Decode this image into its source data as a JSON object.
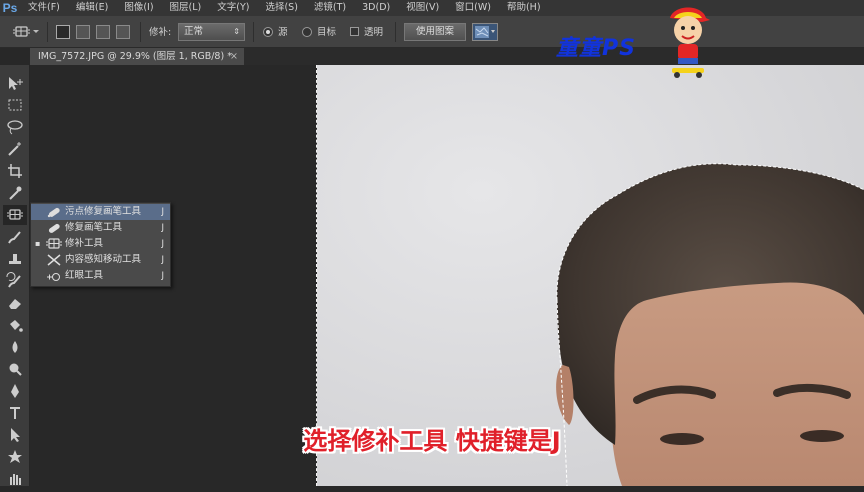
{
  "app": {
    "logo": "Ps"
  },
  "menu": [
    "文件(F)",
    "编辑(E)",
    "图像(I)",
    "图层(L)",
    "文字(Y)",
    "选择(S)",
    "滤镜(T)",
    "3D(D)",
    "视图(V)",
    "窗口(W)",
    "帮助(H)"
  ],
  "options": {
    "patch_label": "修补:",
    "patch_value": "正常",
    "source_label": "源",
    "dest_label": "目标",
    "transparent_label": "透明",
    "use_pattern_label": "使用图案",
    "source_selected": true
  },
  "document": {
    "tab_title": "IMG_7572.JPG @ 29.9% (图层 1, RGB/8) *",
    "close": "×"
  },
  "flyout": {
    "items": [
      {
        "icon": "spot-healing-brush-icon",
        "label": "污点修复画笔工具",
        "key": "J",
        "highlighted": true,
        "current": false
      },
      {
        "icon": "healing-brush-icon",
        "label": "修复画笔工具",
        "key": "J",
        "highlighted": false,
        "current": false
      },
      {
        "icon": "patch-tool-icon",
        "label": "修补工具",
        "key": "J",
        "highlighted": false,
        "current": true
      },
      {
        "icon": "content-aware-move-icon",
        "label": "内容感知移动工具",
        "key": "J",
        "highlighted": false,
        "current": false
      },
      {
        "icon": "red-eye-icon",
        "label": "红眼工具",
        "key": "J",
        "highlighted": false,
        "current": false
      }
    ],
    "current_marker": "▪"
  },
  "tools": [
    "move-tool-icon",
    "marquee-tool-icon",
    "lasso-tool-icon",
    "magic-wand-icon",
    "crop-tool-icon",
    "eyedropper-icon",
    "patch-tool-icon",
    "brush-tool-icon",
    "clone-stamp-icon",
    "history-brush-icon",
    "eraser-icon",
    "paint-bucket-icon",
    "blur-tool-icon",
    "dodge-tool-icon",
    "pen-tool-icon",
    "type-tool-icon",
    "path-select-icon",
    "shape-tool-icon",
    "hand-tool-icon"
  ],
  "watermark": "童童PS",
  "subtitle": "选择修补工具 快捷键是J",
  "colors": {
    "highlight": "#5a6d8a",
    "subtitle": "#e0202a",
    "watermark": "#1133dd",
    "accent": "#6aa8e8"
  }
}
